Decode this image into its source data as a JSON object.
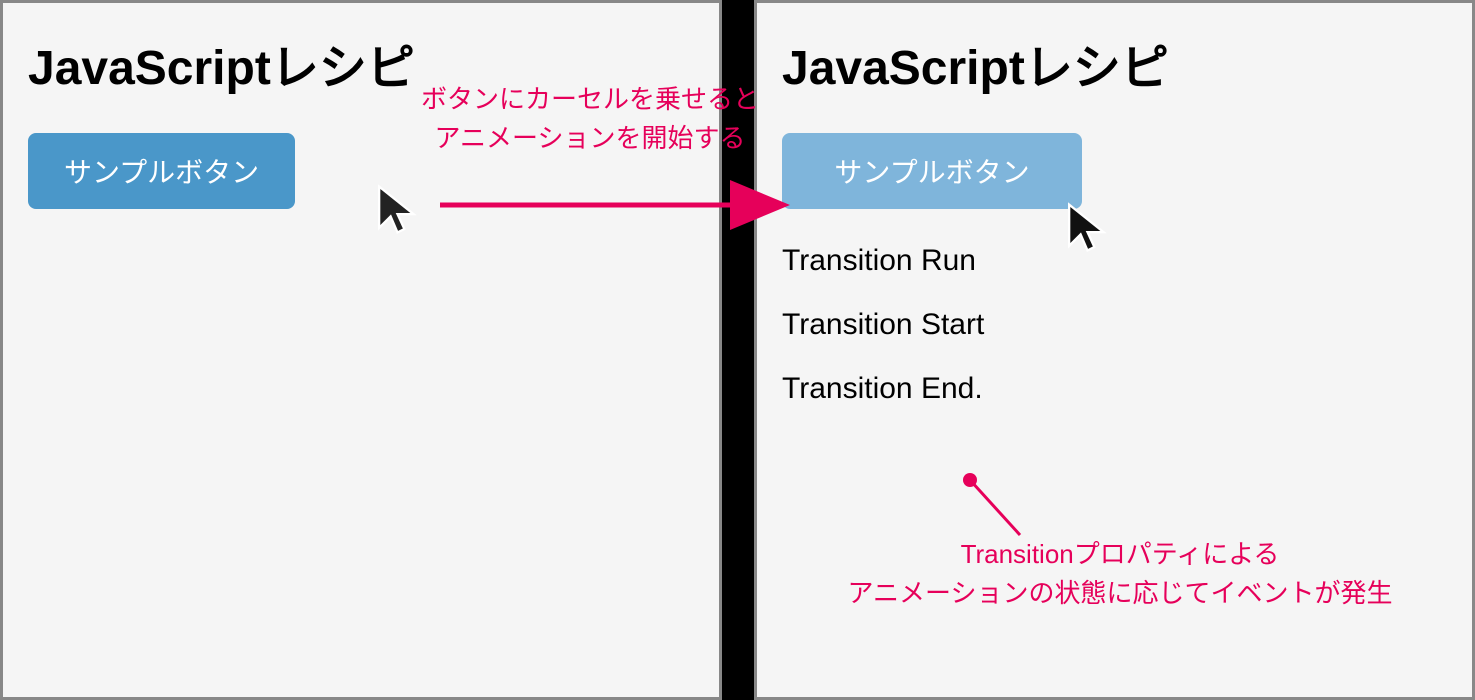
{
  "left": {
    "title": "JavaScriptレシピ",
    "button_label": "サンプルボタン"
  },
  "right": {
    "title": "JavaScriptレシピ",
    "button_label": "サンプルボタン",
    "logs": [
      "Transition Run",
      "Transition Start",
      "Transition End."
    ]
  },
  "annotations": {
    "top_line1": "ボタンにカーセルを乗せると",
    "top_line2": "アニメーションを開始する",
    "bottom_line1": "Transitionプロパティによる",
    "bottom_line2": "アニメーションの状態に応じてイベントが発生"
  },
  "colors": {
    "accent": "#e6005a",
    "button": "#4a97c9",
    "button_hover": "#7fb5db"
  }
}
